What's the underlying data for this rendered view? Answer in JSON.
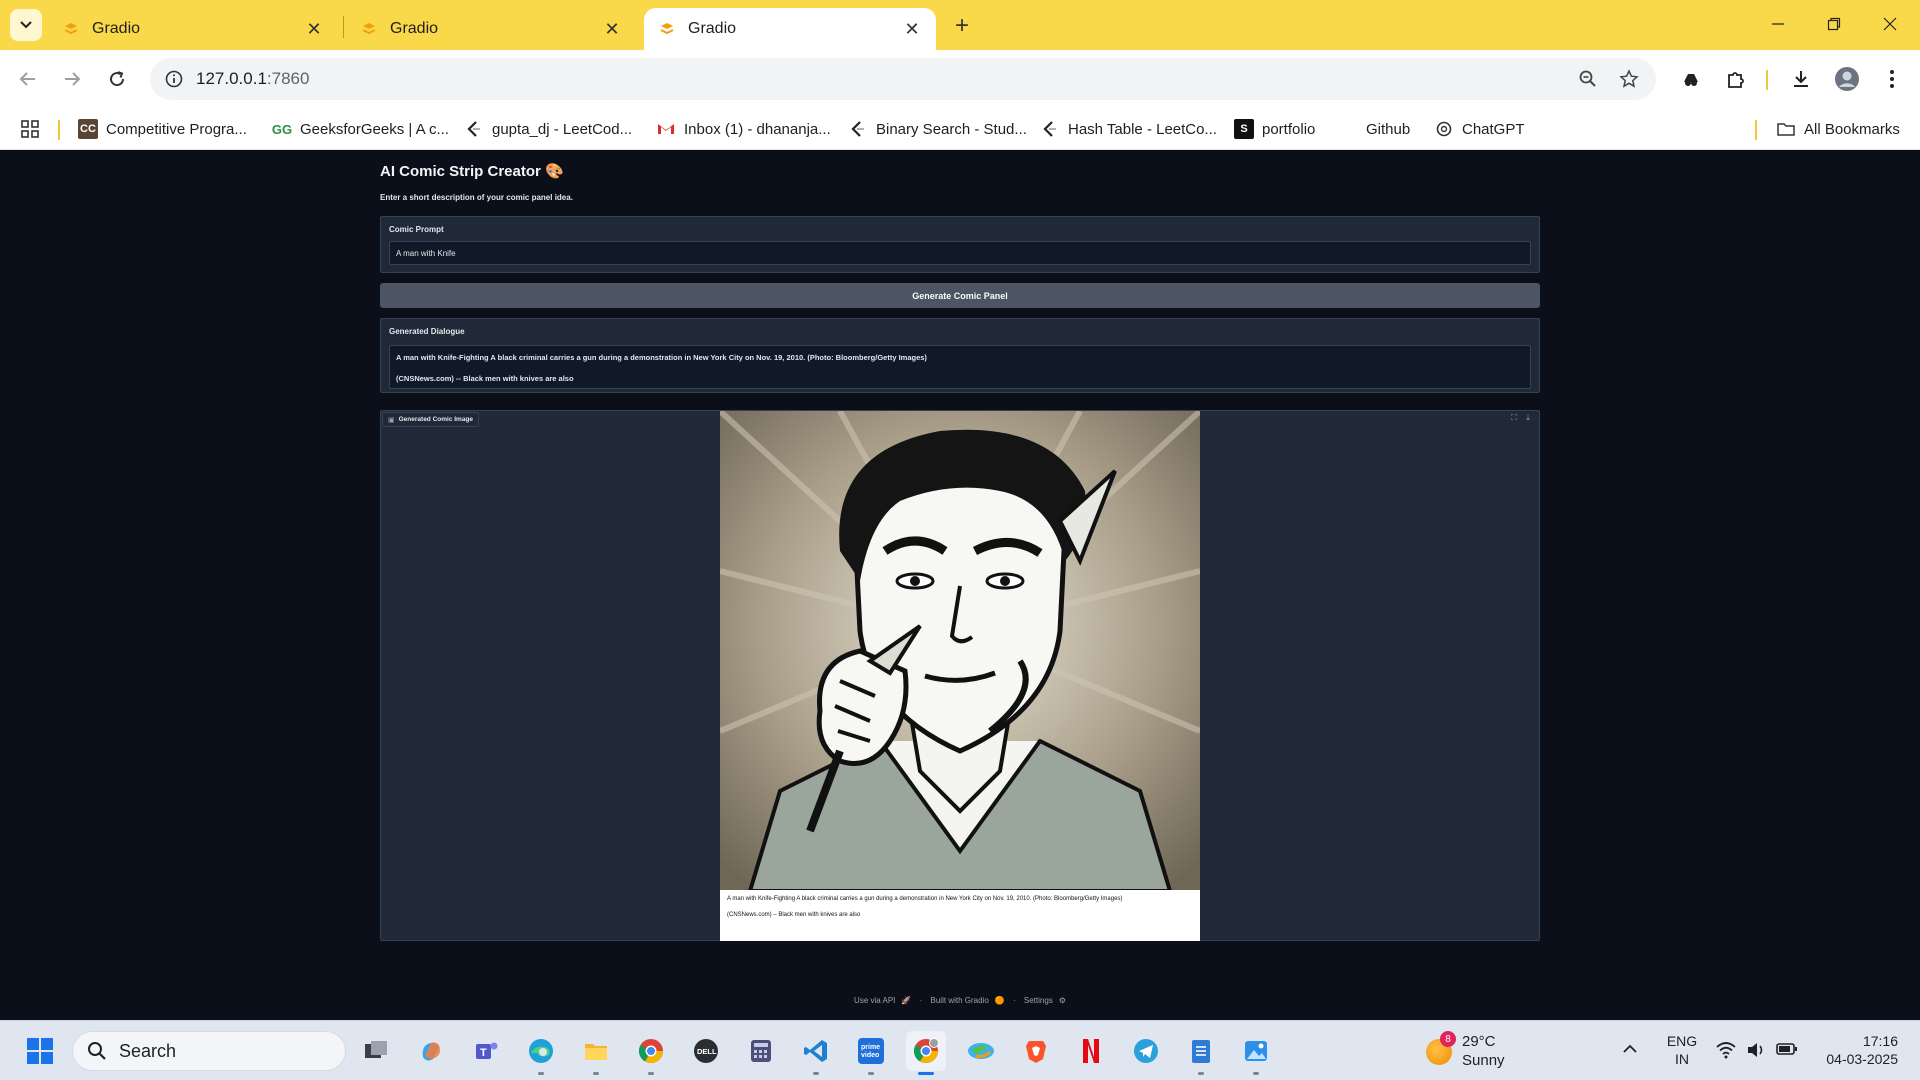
{
  "browser": {
    "tabs": [
      {
        "title": "Gradio",
        "active": false
      },
      {
        "title": "Gradio",
        "active": false
      },
      {
        "title": "Gradio",
        "active": true
      }
    ],
    "url_host": "127.0.0.1",
    "url_port": ":7860",
    "bookmarks": [
      {
        "label": "Competitive Progra...",
        "icon": "cc-icon"
      },
      {
        "label": "GeeksforGeeks | A c...",
        "icon": "gfg-icon"
      },
      {
        "label": "gupta_dj - LeetCod...",
        "icon": "leetcode-icon"
      },
      {
        "label": "Inbox (1) - dhananja...",
        "icon": "gmail-icon"
      },
      {
        "label": "Binary Search - Stud...",
        "icon": "leetcode-icon"
      },
      {
        "label": "Hash Table - LeetCo...",
        "icon": "leetcode-icon"
      },
      {
        "label": "portfolio",
        "icon": "s-icon"
      },
      {
        "label": "Github",
        "icon": "none"
      },
      {
        "label": "ChatGPT",
        "icon": "chatgpt-icon"
      }
    ],
    "all_bookmarks_label": "All Bookmarks"
  },
  "app": {
    "title": "AI Comic Strip Creator 🎨",
    "description": "Enter a short description of your comic panel idea.",
    "prompt_label": "Comic Prompt",
    "prompt_value": "A man with Knife",
    "generate_button": "Generate Comic Panel",
    "dialogue_label": "Generated Dialogue",
    "dialogue_line1": "A man with Knife-Fighting A black criminal carries a gun during a demonstration in New York City on Nov. 19, 2010. (Photo: Bloomberg/Getty Images)",
    "dialogue_line2": "(CNSNews.com) -- Black men with knives are also",
    "image_label": "Generated Comic Image",
    "caption_line1": "A man with Knife-Fighting A black criminal carries a gun during a demonstration in New York City on Nov. 19, 2010. (Photo: Bloomberg/Getty Images)",
    "caption_line2": "(CNSNews.com) – Black men with knives are also"
  },
  "footer": {
    "api": "Use via API",
    "built": "Built with Gradio",
    "settings": "Settings"
  },
  "taskbar": {
    "search_label": "Search",
    "weather_temp": "29°C",
    "weather_cond": "Sunny",
    "weather_badge": "8",
    "lang_top": "ENG",
    "lang_bottom": "IN",
    "time": "17:16",
    "date": "04-03-2025"
  }
}
